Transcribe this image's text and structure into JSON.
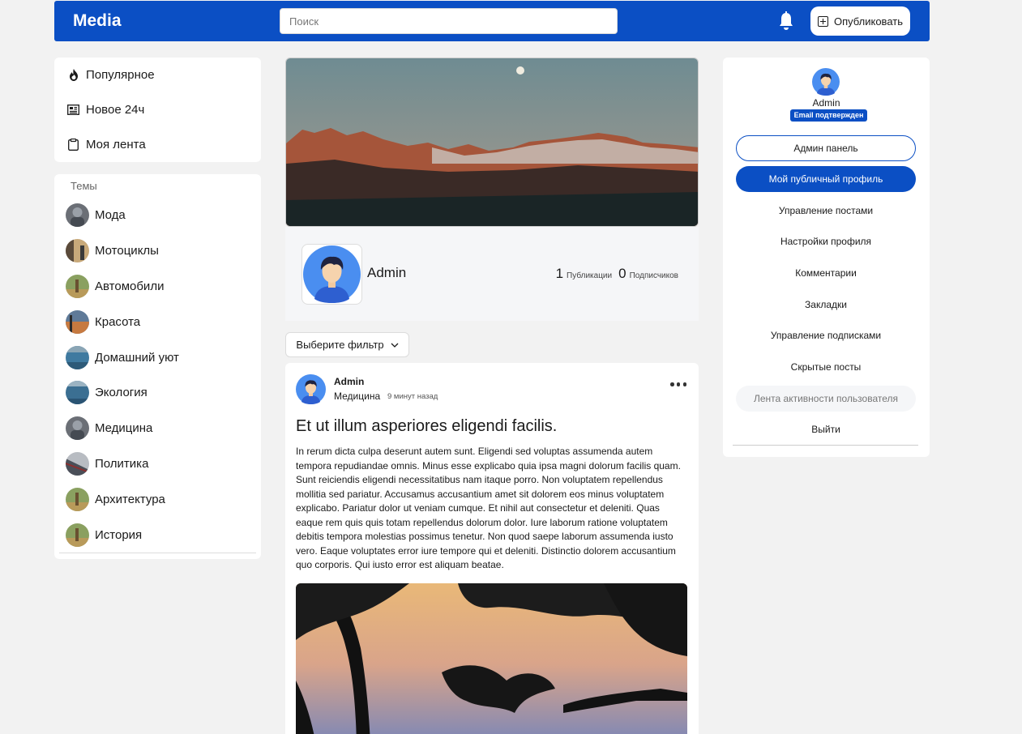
{
  "header": {
    "logo": "Media",
    "search_placeholder": "Поиск",
    "publish_label": "Опубликовать"
  },
  "nav": {
    "items": [
      {
        "label": "Популярное",
        "icon": "fire-icon"
      },
      {
        "label": "Новое 24ч",
        "icon": "newspaper-icon"
      },
      {
        "label": "Моя лента",
        "icon": "clipboard-icon"
      }
    ]
  },
  "topics": {
    "title": "Темы",
    "items": [
      {
        "label": "Мода"
      },
      {
        "label": "Мотоциклы"
      },
      {
        "label": "Автомобили"
      },
      {
        "label": "Красота"
      },
      {
        "label": "Домашний уют"
      },
      {
        "label": "Экология"
      },
      {
        "label": "Медицина"
      },
      {
        "label": "Политика"
      },
      {
        "label": "Архитектура"
      },
      {
        "label": "История"
      }
    ]
  },
  "profile": {
    "name": "Admin",
    "publications_count": "1",
    "publications_label": "Публикации",
    "subscribers_count": "0",
    "subscribers_label": "Подписчиков"
  },
  "filter": {
    "label": "Выберите фильтр"
  },
  "post": {
    "author": "Admin",
    "topic": "Медицина",
    "time": "9 минут назад",
    "title": "Et ut illum asperiores eligendi facilis.",
    "body": "In rerum dicta culpa deserunt autem sunt. Eligendi sed voluptas assumenda autem tempora repudiandae omnis. Minus esse explicabo quia ipsa magni dolorum facilis quam. Sunt reiciendis eligendi necessitatibus nam itaque porro. Non voluptatem repellendus mollitia sed pariatur. Accusamus accusantium amet sit dolorem eos minus voluptatem explicabo. Pariatur dolor ut veniam cumque. Et nihil aut consectetur et deleniti. Quas eaque rem quis quis totam repellendus dolorum dolor. Iure laborum ratione voluptatem debitis tempora molestias possimus tenetur. Non quod saepe laborum assumenda iusto vero. Eaque voluptates error iure tempore qui et deleniti. Distinctio dolorem accusantium quo corporis. Qui iusto error est aliquam beatae."
  },
  "sidebar": {
    "name": "Admin",
    "badge": "Email подтвержден",
    "admin_panel": "Админ панель",
    "public_profile": "Мой публичный профиль",
    "links": [
      "Управление постами",
      "Настройки профиля",
      "Комментарии",
      "Закладки",
      "Управление подписками",
      "Скрытые посты"
    ],
    "activity_feed": "Лента активности пользователя",
    "logout": "Выйти"
  },
  "colors": {
    "brand": "#0b4fc4",
    "background": "#f2f2f2"
  }
}
